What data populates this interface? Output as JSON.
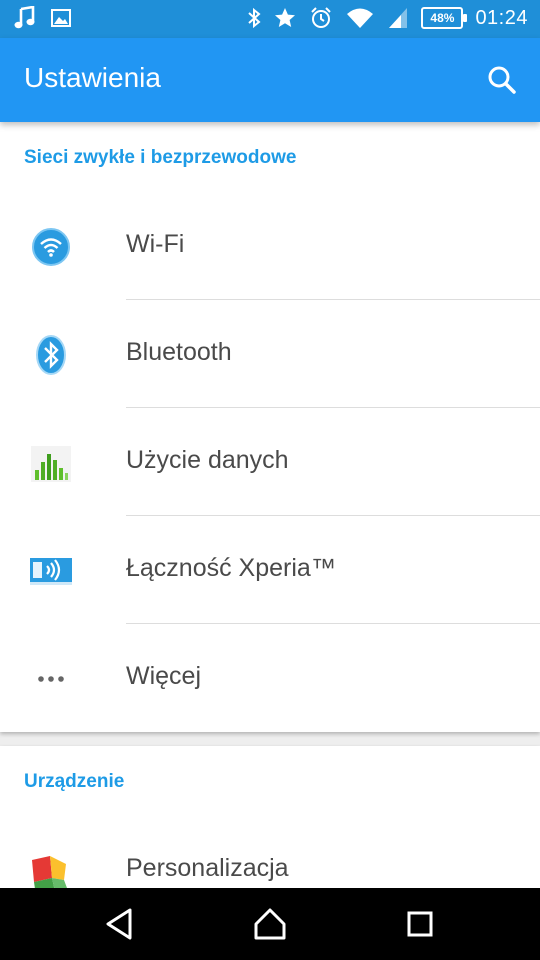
{
  "status_bar": {
    "time": "01:24",
    "battery": "48%",
    "icons": [
      "music-icon",
      "image-icon",
      "bluetooth-icon",
      "star-icon",
      "alarm-icon",
      "wifi-icon",
      "signal-icon",
      "battery-icon"
    ]
  },
  "app_bar": {
    "title": "Ustawienia",
    "search_icon": "search-icon"
  },
  "sections": [
    {
      "title": "Sieci zwykłe i bezprzewodowe",
      "items": [
        {
          "label": "Wi-Fi",
          "icon": "wifi-settings-icon"
        },
        {
          "label": "Bluetooth",
          "icon": "bluetooth-settings-icon"
        },
        {
          "label": "Użycie danych",
          "icon": "data-usage-icon"
        },
        {
          "label": "Łączność Xperia™",
          "icon": "xperia-connectivity-icon"
        },
        {
          "label": "Więcej",
          "icon": "more-icon"
        }
      ]
    },
    {
      "title": "Urządzenie",
      "items": [
        {
          "label": "Personalizacja",
          "icon": "personalization-icon"
        }
      ]
    }
  ],
  "nav_bar": {
    "icons": [
      "back-icon",
      "home-icon",
      "recents-icon"
    ]
  },
  "colors": {
    "status_bar": "#1f8fd8",
    "app_bar": "#2196f3",
    "accent": "#1e9be6"
  }
}
